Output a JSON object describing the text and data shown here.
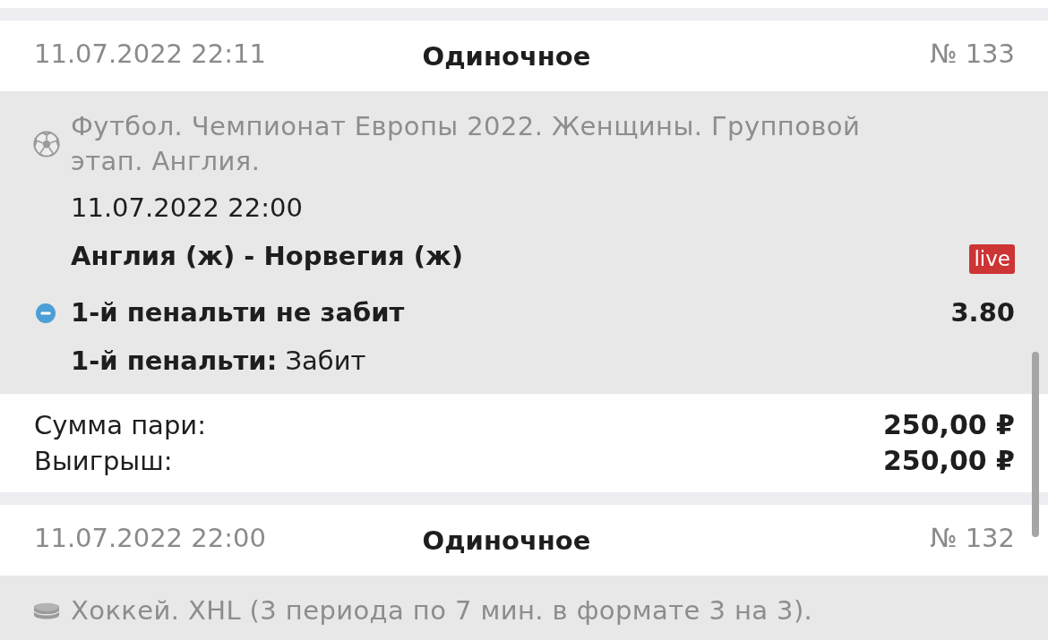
{
  "bets": [
    {
      "date": "11.07.2022 22:11",
      "bet_type": "Одиночное",
      "number": "№ 133",
      "events": [
        {
          "kind": "football",
          "tournament": "Футбол. Чемпионат Европы 2022. Женщины. Групповой этап. Англия.",
          "start": "11.07.2022 22:00",
          "match": "Англия (ж) - Норвегия (ж)",
          "badge": "live",
          "selection": {
            "kind": "minus",
            "name": "1-й пенальти не забит",
            "odds": "3.80"
          },
          "result": "**1-й пенальти:** Забит"
        }
      ],
      "summary": [
        {
          "label": "Сумма пари:",
          "value": "250,00 ₽"
        },
        {
          "label": "Выигрыш:",
          "value": "250,00 ₽"
        }
      ]
    },
    {
      "date": "11.07.2022 22:00",
      "bet_type": "Одиночное",
      "number": "№ 132",
      "events": [
        {
          "kind": "hockey",
          "tournament": "Хоккей. XHL (3 периода по 7 мин. в формате 3 на 3)."
        }
      ]
    }
  ]
}
